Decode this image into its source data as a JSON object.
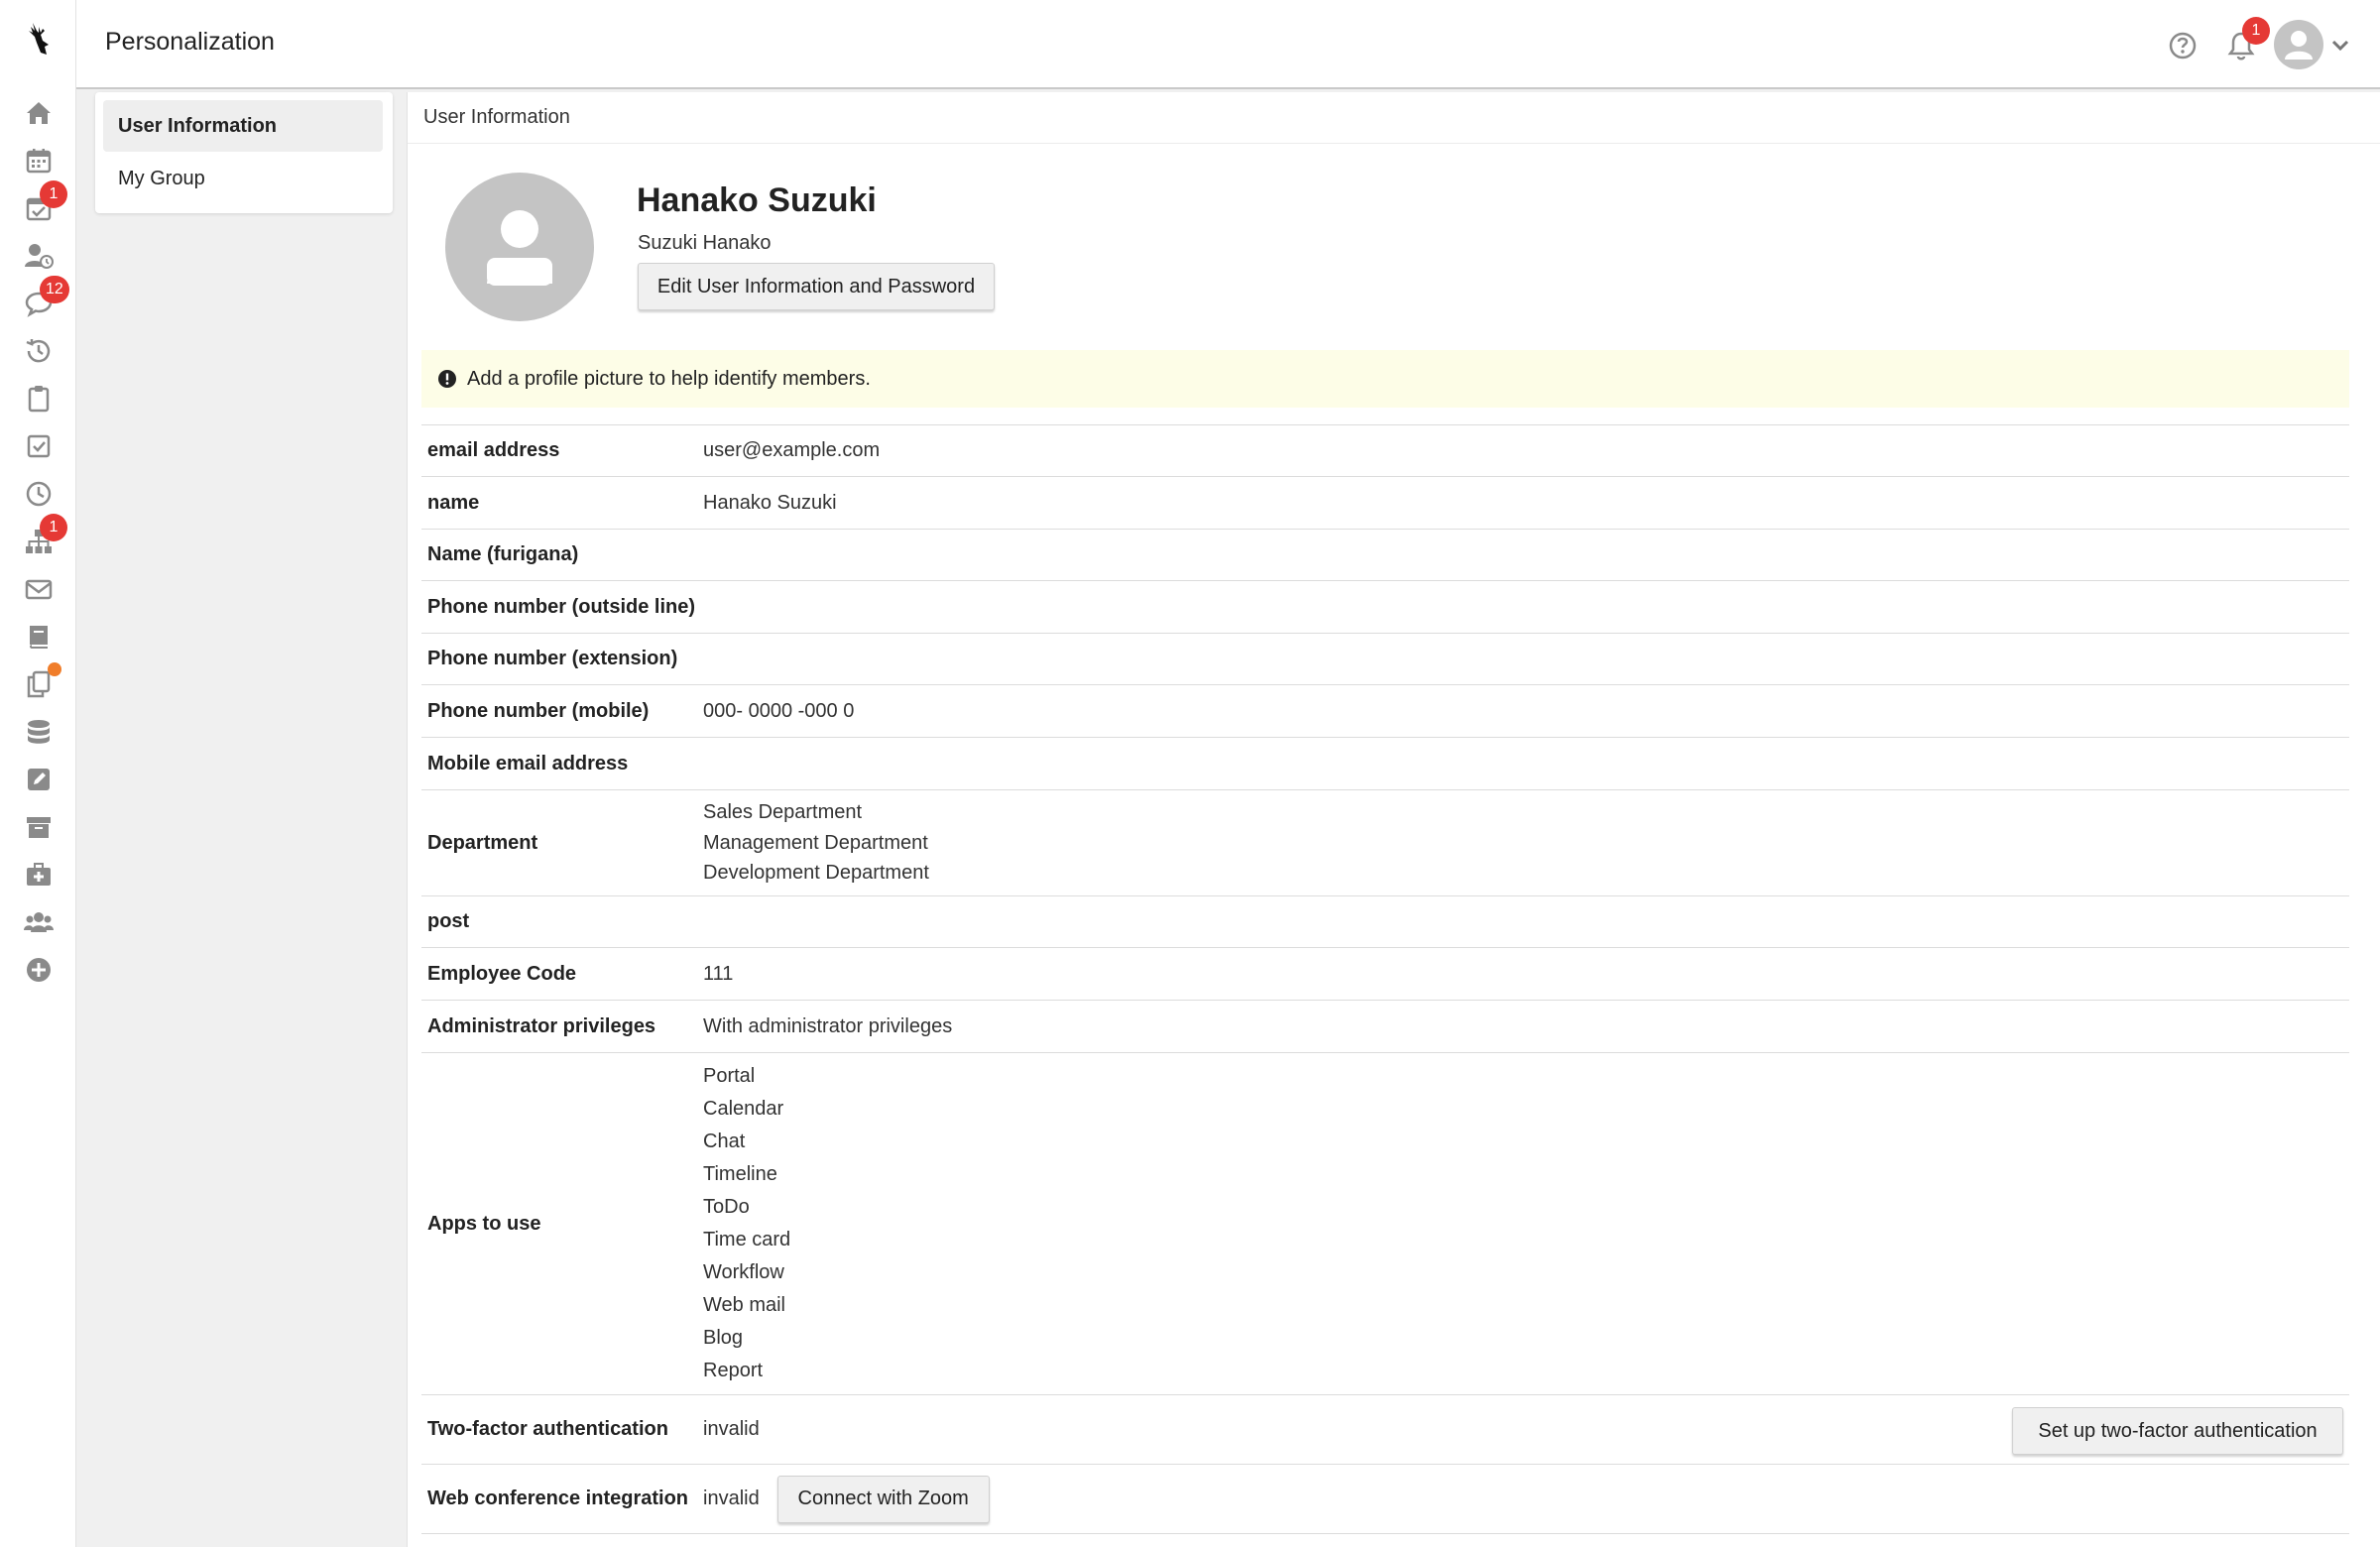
{
  "header": {
    "title": "Personalization",
    "notifications_count": "1"
  },
  "rail": {
    "badges": {
      "todo": "1",
      "chat": "12",
      "workflow": "1"
    }
  },
  "subnav": {
    "items": [
      {
        "label": "User Information"
      },
      {
        "label": "My Group"
      }
    ]
  },
  "main": {
    "title": "User Information",
    "profile": {
      "name": "Hanako Suzuki",
      "name_kana": "Suzuki Hanako",
      "edit_button": "Edit User Information and Password"
    },
    "notice": "Add a profile picture to help identify members.",
    "fields": {
      "email": {
        "label": "email address",
        "value": "user@example.com"
      },
      "name": {
        "label": "name",
        "value": "Hanako Suzuki"
      },
      "furigana": {
        "label": "Name (furigana)",
        "value": ""
      },
      "phone_outside": {
        "label": "Phone number (outside line)",
        "value": ""
      },
      "phone_extension": {
        "label": "Phone number (extension)",
        "value": ""
      },
      "phone_mobile": {
        "label": "Phone number (mobile)",
        "value": "000- 0000 -000 0"
      },
      "mobile_email": {
        "label": "Mobile email address",
        "value": ""
      },
      "department": {
        "label": "Department",
        "values": [
          "Sales Department",
          "Management Department",
          "Development Department"
        ]
      },
      "post": {
        "label": "post",
        "value": ""
      },
      "employee_code": {
        "label": "Employee Code",
        "value": "111"
      },
      "admin": {
        "label": "Administrator privileges",
        "value": "With administrator privileges"
      },
      "apps": {
        "label": "Apps to use",
        "values": [
          "Portal",
          "Calendar",
          "Chat",
          "Timeline",
          "ToDo",
          "Time card",
          "Workflow",
          "Web mail",
          "Blog",
          "Report"
        ]
      },
      "two_factor": {
        "label": "Two-factor authentication",
        "value": "invalid",
        "button": "Set up two-factor authentication"
      },
      "web_conf": {
        "label": "Web conference integration",
        "value": "invalid",
        "button": "Connect with Zoom"
      }
    }
  },
  "colors": {
    "badge": "#e53935",
    "dot": "#f07d2a",
    "notice_bg": "#fdfde7",
    "icon_gray": "#8a8a8a"
  }
}
